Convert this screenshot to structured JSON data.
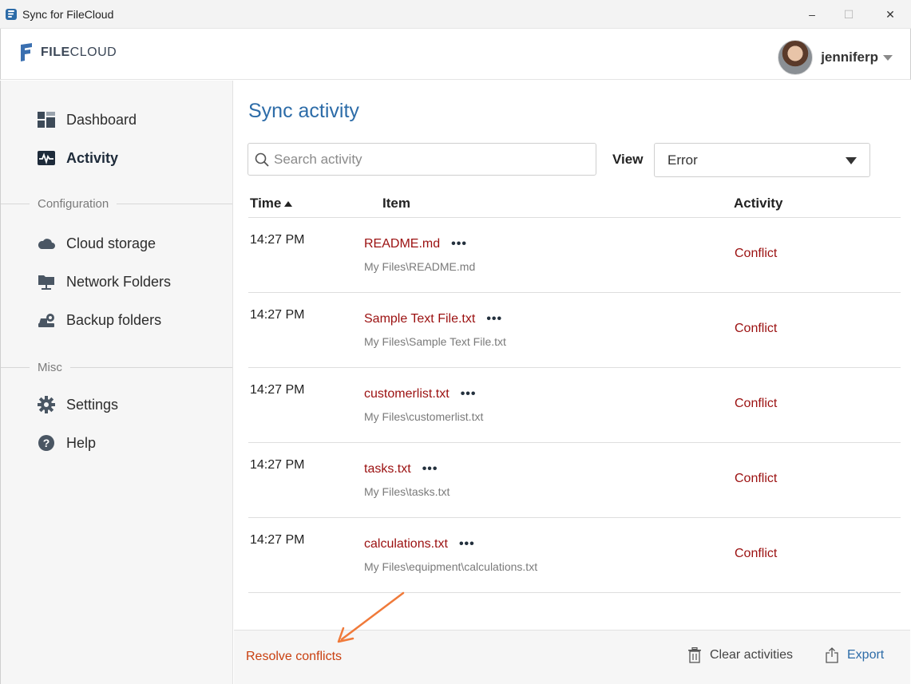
{
  "window": {
    "title": "Sync for FileCloud",
    "minimize_glyph": "–",
    "maximize_glyph": "☐",
    "close_glyph": "✕"
  },
  "header": {
    "logo_text_bold": "FILE",
    "logo_text_rest": "CLOUD",
    "username": "jenniferp"
  },
  "sidebar": {
    "items_main": [
      {
        "label": "Dashboard",
        "icon": "dashboard-icon"
      },
      {
        "label": "Activity",
        "icon": "activity-icon",
        "active": true
      }
    ],
    "section_configuration": "Configuration",
    "items_config": [
      {
        "label": "Cloud storage",
        "icon": "cloud-icon"
      },
      {
        "label": "Network Folders",
        "icon": "network-folder-icon"
      },
      {
        "label": "Backup folders",
        "icon": "backup-icon"
      }
    ],
    "section_misc": "Misc",
    "items_misc": [
      {
        "label": "Settings",
        "icon": "gear-icon"
      },
      {
        "label": "Help",
        "icon": "help-icon"
      }
    ]
  },
  "main": {
    "title": "Sync activity",
    "search_placeholder": "Search activity",
    "view_label": "View",
    "view_value": "Error",
    "columns": {
      "time": "Time",
      "item": "Item",
      "activity": "Activity"
    },
    "rows": [
      {
        "time": "14:27 PM",
        "name": "README.md",
        "more": "•••",
        "path": "My Files\\README.md",
        "activity": "Conflict"
      },
      {
        "time": "14:27 PM",
        "name": "Sample Text File.txt",
        "more": "•••",
        "path": "My Files\\Sample Text File.txt",
        "activity": "Conflict"
      },
      {
        "time": "14:27 PM",
        "name": "customerlist.txt",
        "more": "•••",
        "path": "My Files\\customerlist.txt",
        "activity": "Conflict"
      },
      {
        "time": "14:27 PM",
        "name": "tasks.txt",
        "more": "•••",
        "path": "My Files\\tasks.txt",
        "activity": "Conflict"
      },
      {
        "time": "14:27 PM",
        "name": "calculations.txt",
        "more": "•••",
        "path": "My Files\\equipment\\calculations.txt",
        "activity": "Conflict"
      }
    ]
  },
  "footer": {
    "resolve_label": "Resolve conflicts",
    "clear_label": "Clear activities",
    "export_label": "Export"
  },
  "colors": {
    "accent_blue": "#2d6ca8",
    "conflict_red": "#9b1010",
    "resolve_orange": "#c94010",
    "annotation_arrow": "#f07a3a"
  }
}
